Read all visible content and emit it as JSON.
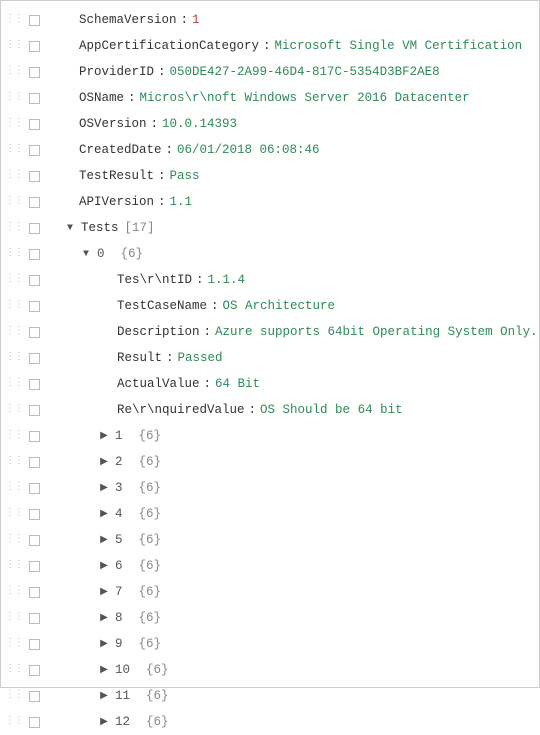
{
  "top": {
    "SchemaVersion": {
      "key": "SchemaVersion",
      "value": "1",
      "type": "num"
    },
    "AppCertificationCategory": {
      "key": "AppCertificationCategory",
      "value": "Microsoft Single VM Certification",
      "type": "str"
    },
    "ProviderID": {
      "key": "ProviderID",
      "value": "050DE427-2A99-46D4-817C-5354D3BF2AE8",
      "type": "str"
    },
    "OSName": {
      "key": "OSName",
      "value": "Micros\\r\\noft Windows Server 2016 Datacenter",
      "type": "str"
    },
    "OSVersion": {
      "key": "OSVersion",
      "value": "10.0.14393",
      "type": "str"
    },
    "CreatedDate": {
      "key": "CreatedDate",
      "value": "06/01/2018 06:08:46",
      "type": "str"
    },
    "TestResult": {
      "key": "TestResult",
      "value": "Pass",
      "type": "str"
    },
    "APIVersion": {
      "key": "APIVersion",
      "value": "1.1",
      "type": "str"
    }
  },
  "tests": {
    "label": "Tests",
    "count": "[17]",
    "expanded": {
      "index": "0",
      "size": "{6}",
      "items": {
        "TestID": {
          "key": "Tes\\r\\ntID",
          "value": "1.1.4"
        },
        "TestCaseName": {
          "key": "TestCaseName",
          "value": "OS Architecture"
        },
        "Description": {
          "key": "Description",
          "value": "Azure supports 64bit Operating System Only."
        },
        "Result": {
          "key": "Result",
          "value": "Passed"
        },
        "ActualValue": {
          "key": "ActualValue",
          "value": "64 Bit"
        },
        "RequiredValue": {
          "key": "Re\\r\\nquiredValue",
          "value": "OS Should be 64 bit"
        }
      }
    },
    "collapsed": [
      {
        "index": "1",
        "size": "{6}"
      },
      {
        "index": "2",
        "size": "{6}"
      },
      {
        "index": "3",
        "size": "{6}"
      },
      {
        "index": "4",
        "size": "{6}"
      },
      {
        "index": "5",
        "size": "{6}"
      },
      {
        "index": "6",
        "size": "{6}"
      },
      {
        "index": "7",
        "size": "{6}"
      },
      {
        "index": "8",
        "size": "{6}"
      },
      {
        "index": "9",
        "size": "{6}"
      },
      {
        "index": "10",
        "size": "{6}"
      },
      {
        "index": "11",
        "size": "{6}"
      },
      {
        "index": "12",
        "size": "{6}"
      }
    ]
  }
}
